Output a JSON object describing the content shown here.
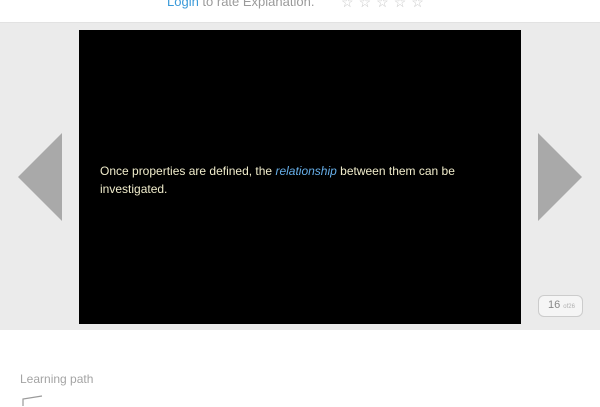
{
  "rating": {
    "login_label": "Login",
    "prompt": " to rate Explanation.",
    "stars": [
      "☆",
      "☆",
      "☆",
      "☆",
      "☆"
    ]
  },
  "slide": {
    "text_before": "Once properties are defined, the ",
    "highlight": "relationship",
    "text_after": " between them can be investigated."
  },
  "navigation": {
    "prev_icon": "arrow-left-icon",
    "next_icon": "arrow-right-icon"
  },
  "counter": {
    "current": "16",
    "of": "of26"
  },
  "learning_path": {
    "label": "Learning path",
    "icon": "path-icon"
  },
  "colors": {
    "link": "#3a9ad9",
    "highlight": "#66aee8",
    "slide_text": "#f0eccb",
    "slide_bg": "#000000",
    "stage_bg": "#ebebeb",
    "arrow": "#a9a9a9"
  }
}
